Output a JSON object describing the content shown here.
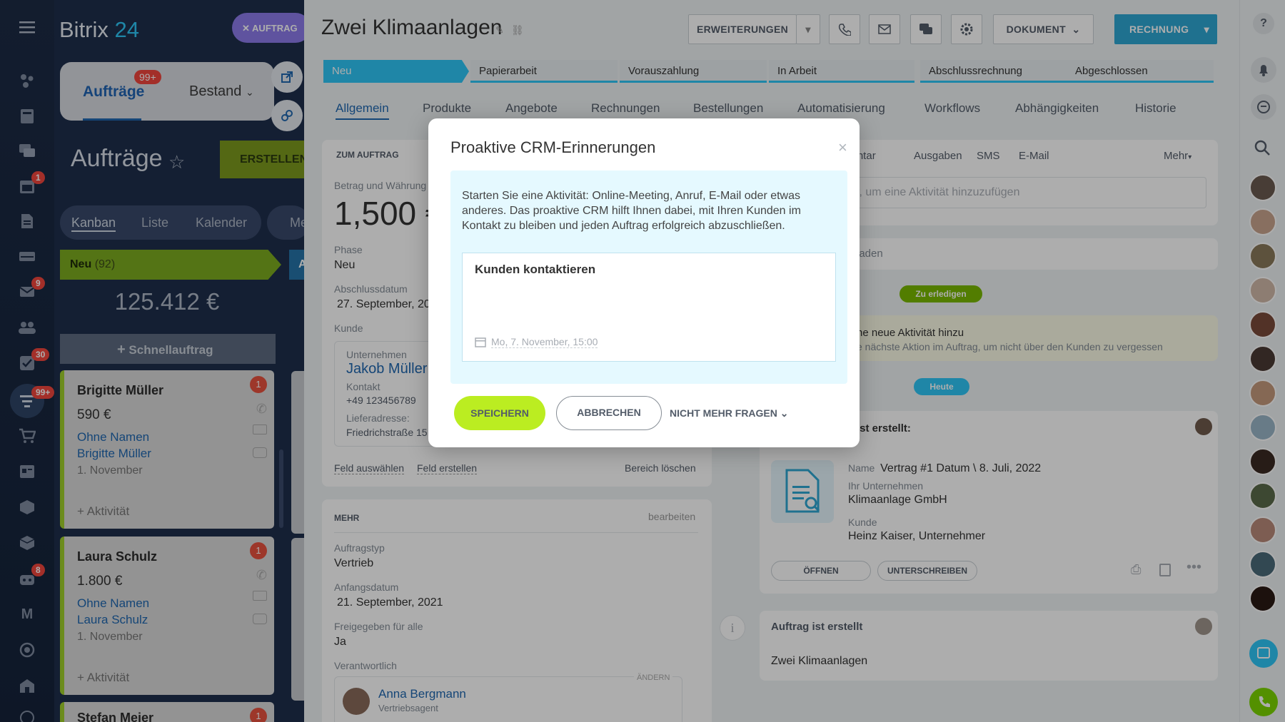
{
  "brand": {
    "name_a": "Bitrix",
    "name_b": " 24"
  },
  "auftrag_chip": "AUFTRAG",
  "left": {
    "tab_active": "Aufträge",
    "tab_active_badge": "99+",
    "tab_other": "Bestand",
    "title": "Aufträge",
    "create_button": "ERSTELLEN",
    "views": [
      "Kanban",
      "Liste",
      "Kalender",
      "Me"
    ],
    "column": {
      "name": "Neu",
      "count": "(92)",
      "sum": "125.412 €",
      "quick": "Schnellauftrag"
    },
    "cards": [
      {
        "name": "Brigitte Müller",
        "amount": "590 €",
        "link1": "Ohne Namen",
        "link2": "Brigitte Müller",
        "date": "1. November",
        "activity": "+ Aktivität",
        "count": "1"
      },
      {
        "name": "Laura Schulz",
        "amount": "1.800 €",
        "link1": "Ohne Namen",
        "link2": "Laura Schulz",
        "date": "1. November",
        "activity": "+ Aktivität",
        "count": "1"
      },
      {
        "name": "Stefan Meier",
        "count": "1"
      }
    ],
    "second_column_initial": "A"
  },
  "rail_badges": {
    "calendar": "1",
    "mail": "9",
    "tasks": "30",
    "crm": "99+",
    "robots": "8"
  },
  "rail_m": "M",
  "deal": {
    "title": "Zwei Klimaanlagen",
    "toolbar": {
      "extensions": "ERWEITERUNGEN",
      "document": "DOKUMENT",
      "invoice": "RECHNUNG"
    },
    "stages": [
      "Neu",
      "Papierarbeit",
      "Vorauszahlung",
      "In Arbeit",
      "Abschlussrechnung",
      "Abgeschlossen"
    ],
    "tabs": [
      "Allgemein",
      "Produkte",
      "Angebote",
      "Rechnungen",
      "Bestellungen",
      "Automatisierung",
      "Workflows",
      "Abhängigkeiten",
      "Historie"
    ],
    "section_about": "ZUM AUFTRAG",
    "amount_label": "Betrag und Währung",
    "amount_value": "1,500 €",
    "phase_label": "Phase",
    "phase_value": "Neu",
    "close_label": "Abschlussdatum",
    "close_value": "27. September, 20",
    "client_label": "Kunde",
    "company_label": "Unternehmen",
    "company_value": "Jakob Müller",
    "contact_label": "Kontakt",
    "contact_value": "+49 123456789",
    "address_label": "Lieferadresse:",
    "address_value": "Friedrichstraße 15",
    "field_select": "Feld auswählen",
    "field_create": "Feld erstellen",
    "clear_section": "Bereich löschen",
    "more_section": "MEHR",
    "edit": "bearbeiten",
    "type_label": "Auftragstyp",
    "type_value": "Vertrieb",
    "start_label": "Anfangsdatum",
    "start_value": "21. September, 2021",
    "shared_label": "Freigegeben für alle",
    "shared_value": "Ja",
    "responsible_label": "Verantwortlich",
    "change": "ÄNDERN",
    "responsible_name": "Anna Bergmann",
    "responsible_role": "Vertriebsagent"
  },
  "timeline": {
    "tabs": [
      "mentar",
      "Ausgaben",
      "SMS",
      "E-Mail"
    ],
    "more": "Mehr",
    "input_placeholder": "r, um eine Aktivität hinzuzufügen",
    "load": "laden",
    "todo_pill": "Zu erledigen",
    "hint_title": "ne neue Aktivität hinzu",
    "hint_text": "e nächste Aktion im Auftrag, um nicht über den Kunden zu vergessen",
    "today_pill": "Heute",
    "doc_header": "ist erstellt:",
    "doc_name_label": "Name",
    "doc_name_value": "Vertrag #1 Datum \\ 8. Juli, 2022",
    "doc_company_label": "Ihr Unternehmen",
    "doc_company_value": "Klimaanlage GmbH",
    "doc_client_label": "Kunde",
    "doc_client_value": "Heinz Kaiser, Unternehmer",
    "open": "ÖFFNEN",
    "sign": "UNTERSCHREIBEN",
    "created_header": "Auftrag ist erstellt",
    "created_value": "Zwei Klimaanlagen"
  },
  "modal": {
    "title": "Proaktive CRM-Erinnerungen",
    "text": "Starten Sie eine Aktivität: Online-Meeting, Anruf, E-Mail oder etwas anderes. Das proaktive CRM hilft Ihnen dabei, mit Ihren Kunden im Kontakt zu bleiben und jeden Auftrag erfolgreich abzuschließen.",
    "task_title": "Kunden kontaktieren",
    "task_date": "Mo, 7. November, 15:00",
    "save": "SPEICHERN",
    "cancel": "ABBRECHEN",
    "dont_ask": "NICHT MEHR FRAGEN"
  },
  "colors": {
    "accent_blue": "#2fc6f6",
    "save_green": "#bbed21",
    "create_green": "#9dcf00",
    "badge_red": "#f0463d"
  }
}
